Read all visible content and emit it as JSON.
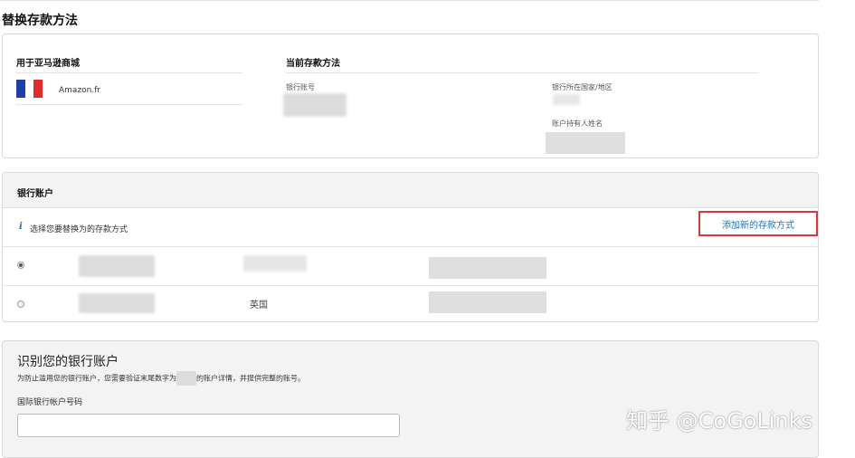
{
  "page": {
    "title": "替换存款方法"
  },
  "marketplace": {
    "header": "用于亚马逊商城",
    "name": "Amazon.fr",
    "flag_colors": [
      "#1f3fa8",
      "#ffffff",
      "#e02b2b"
    ]
  },
  "current_method": {
    "header": "当前存款方法",
    "account_label": "银行账号",
    "country_label": "银行所在国家/地区",
    "holder_label": "账户持有人姓名"
  },
  "bank_accounts": {
    "title": "银行账户",
    "info_icon": "i",
    "info_text": "选择您要替换为的存款方式",
    "add_button": "添加新的存款方式",
    "rows": [
      {
        "selected": true,
        "country": ""
      },
      {
        "selected": false,
        "country": "英国"
      }
    ]
  },
  "verify": {
    "title": "识别您的银行账户",
    "desc_before": "为防止滥用您的银行账户，您需要验证末尾数字为",
    "desc_after": "的账户详情，并提供完整的账号。",
    "iban_label": "国际银行帐户号码",
    "iban_value": "",
    "iban_placeholder": ""
  },
  "watermark": {
    "text": "知乎 @CoGoLinks"
  },
  "colors": {
    "accent_link": "#1f6fb5",
    "highlight_border": "#d43a3a"
  }
}
